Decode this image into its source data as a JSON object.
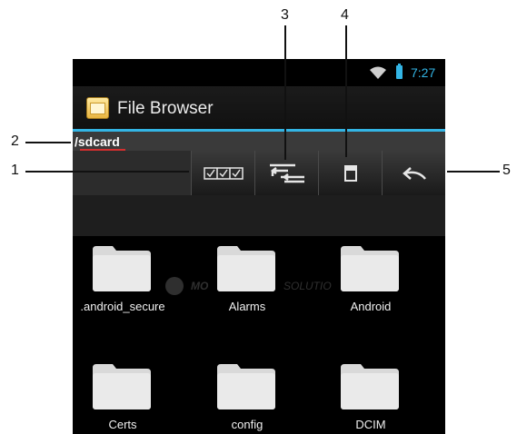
{
  "status_bar": {
    "time": "7:27",
    "wifi_icon": "wifi-icon",
    "battery_icon": "battery-icon",
    "accent_color": "#33b5e5"
  },
  "action_bar": {
    "app_icon": "folder-app-icon",
    "title": "File Browser"
  },
  "path_bar": {
    "path": "/sdcard"
  },
  "toolbar": {
    "buttons": [
      {
        "name": "select-all-button",
        "icon": "checkbox-multi-icon"
      },
      {
        "name": "sort-button",
        "icon": "swap-arrows-icon"
      },
      {
        "name": "sd-card-button",
        "icon": "sd-card-icon"
      },
      {
        "name": "back-button",
        "icon": "back-arrow-icon"
      }
    ]
  },
  "watermark": {
    "brand_left": "MO",
    "brand_right": "SOLUTIO"
  },
  "folders": [
    {
      "label": ".android_secure"
    },
    {
      "label": "Alarms"
    },
    {
      "label": "Android"
    },
    {
      "label": "Certs"
    },
    {
      "label": "config"
    },
    {
      "label": "DCIM"
    }
  ],
  "callouts": {
    "c1": "1",
    "c2": "2",
    "c3": "3",
    "c4": "4",
    "c5": "5"
  }
}
